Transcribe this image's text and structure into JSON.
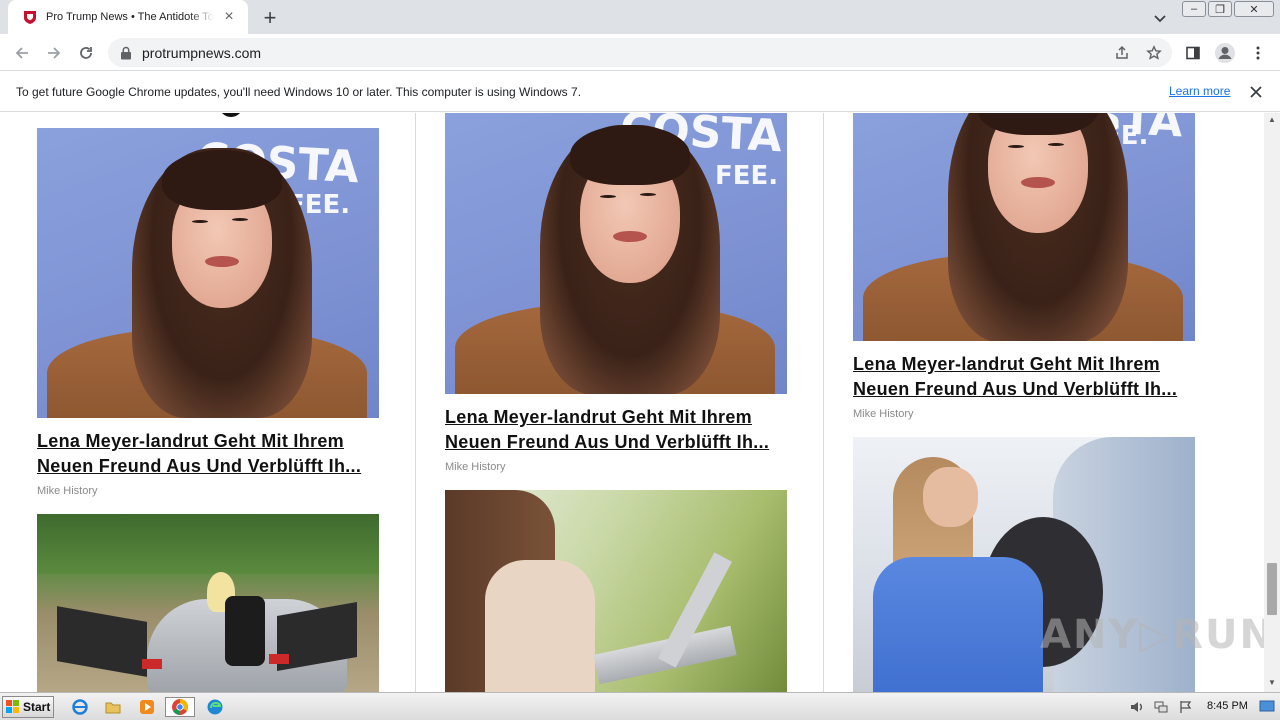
{
  "browser": {
    "tab_title": "Pro Trump News • The Antidote To M",
    "tab_close": "×",
    "new_tab": "+",
    "url": "protrumpnews.com",
    "win_min": "–",
    "win_restore": "❐",
    "win_close": "✕"
  },
  "infobar": {
    "message": "To get future Google Chrome updates, you'll need Windows 10 or later. This computer is using Windows 7.",
    "learn_more": "Learn more"
  },
  "columns": [
    {
      "cards": [
        {
          "title": "Lena Meyer-landrut Geht Mit Ihrem Neuen Freund Aus Und Verblüfft Ih...",
          "author": "Mike History",
          "image": "woman-portrait-costa-backdrop"
        },
        {
          "image": "blonde-woman-silver-sports-car-dirt-road"
        }
      ]
    },
    {
      "cards": [
        {
          "title": "Lena Meyer-landrut Geht Mit Ihrem Neuen Freund Aus Und Verblüfft Ih...",
          "author": "Mike History",
          "image": "woman-portrait-costa-backdrop"
        },
        {
          "image": "woman-using-laptop-outdoors"
        }
      ]
    },
    {
      "cards": [
        {
          "title": "Lena Meyer-landrut Geht Mit Ihrem Neuen Freund Aus Und Verblüfft Ih...",
          "author": "Mike History",
          "image": "woman-portrait-costa-backdrop"
        },
        {
          "image": "woman-on-phone-beside-damaged-car"
        }
      ]
    }
  ],
  "backdrop_text": {
    "costa": "COSTA",
    "costa_partial": "OSTA",
    "fee": "FEE.",
    "fee_partial": "EE."
  },
  "watermark": "ANY▷RUN",
  "taskbar": {
    "start": "Start",
    "clock": "8:45 PM"
  },
  "colors": {
    "tab_strip": "#dee1e6",
    "link_blue": "#1a73e8",
    "headline": "#111111",
    "byline": "#8a8a8a"
  }
}
